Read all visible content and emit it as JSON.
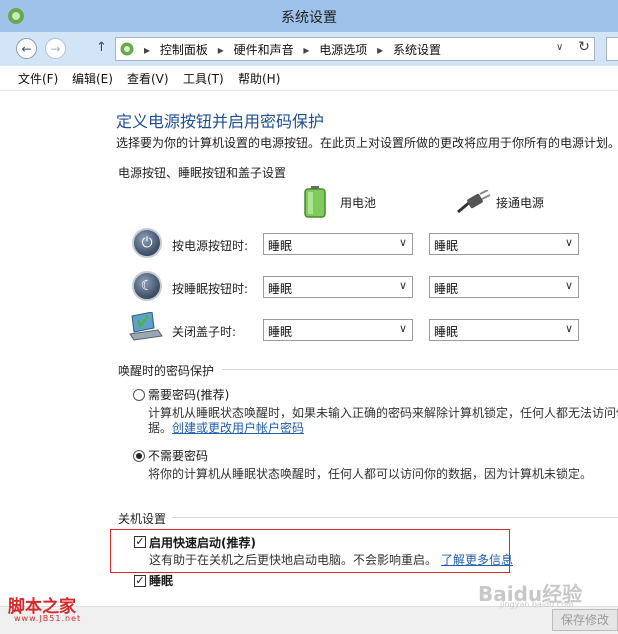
{
  "window": {
    "title": "系统设置"
  },
  "address": {
    "crumbs": [
      "控制面板",
      "硬件和声音",
      "电源选项",
      "系统设置"
    ]
  },
  "menu": [
    "文件(F)",
    "编辑(E)",
    "查看(V)",
    "工具(T)",
    "帮助(H)"
  ],
  "page": {
    "heading": "定义电源按钮并启用密码保护",
    "subtext": "选择要为你的计算机设置的电源按钮。在此页上对设置所做的更改将应用于你所有的电源计划。"
  },
  "power": {
    "section_title": "电源按钮、睡眠按钮和盖子设置",
    "col_battery": "用电池",
    "col_plugged": "接通电源",
    "rows": [
      {
        "label": "按电源按钮时:",
        "battery": "睡眠",
        "plugged": "睡眠"
      },
      {
        "label": "按睡眠按钮时:",
        "battery": "睡眠",
        "plugged": "睡眠"
      },
      {
        "label": "关闭盖子时:",
        "battery": "睡眠",
        "plugged": "睡眠"
      }
    ]
  },
  "password": {
    "section_title": "唤醒时的密码保护",
    "opt1_label": "需要密码(推荐)",
    "opt1_desc_line1": "计算机从睡眠状态唤醒时，如果未输入正确的密码来解除计算机锁定，任何人都无法访问你",
    "opt1_desc_line2_prefix": "据。",
    "opt1_link": "创建或更改用户帐户密码",
    "opt2_label": "不需要密码",
    "opt2_desc": "将你的计算机从睡眠状态唤醒时，任何人都可以访问你的数据，因为计算机未锁定。",
    "selected": "opt2"
  },
  "shutdown": {
    "section_title": "关机设置",
    "fast_label": "启用快速启动(推荐)",
    "fast_desc": "这有助于在关机之后更快地启动电脑。不会影响重启。",
    "fast_link": "了解更多信息",
    "fast_checked": true,
    "sleep_label": "睡眠",
    "sleep_checked": true
  },
  "footer": {
    "save_label": "保存修改"
  },
  "watermarks": {
    "left_main": "脚本之家",
    "left_sub": "www.JB51.net",
    "right_main": "Baidu经验",
    "right_sub": "jingyan.baidu.com"
  },
  "colors": {
    "heading": "#1f4f96",
    "link": "#1f5fae",
    "highlight": "#d62b2b",
    "titlebar": "#9ec2ea"
  }
}
